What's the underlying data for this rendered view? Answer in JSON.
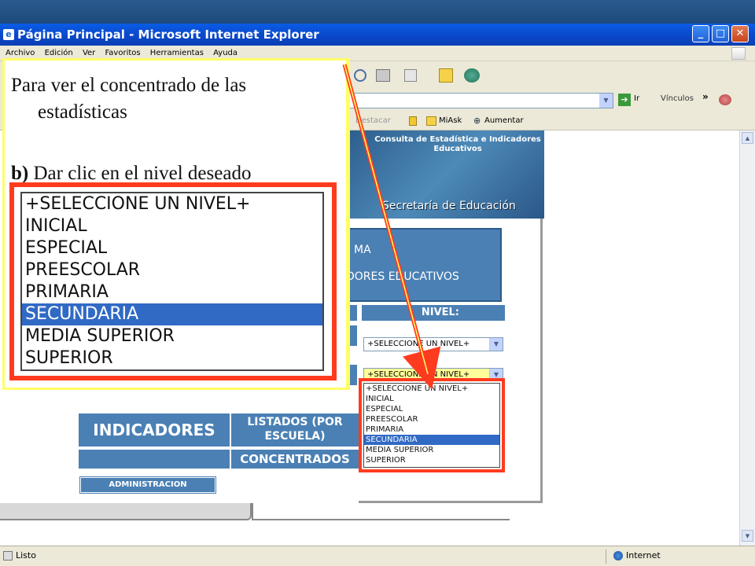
{
  "window": {
    "title": "Página Principal - Microsoft Internet Explorer",
    "controls": {
      "minimize": "_",
      "maximize": "□",
      "close": "✕"
    }
  },
  "menubar": {
    "items": [
      "Archivo",
      "Edición",
      "Ver",
      "Favoritos",
      "Herramientas",
      "Ayuda"
    ]
  },
  "addressbar": {
    "go_label": "Ir",
    "links_label": "Vínculos"
  },
  "linksbar": {
    "items": [
      "Destacar",
      "MiAsk",
      "Aumentar"
    ]
  },
  "callout": {
    "line1": "Para ver el concentrado de las",
    "line2": "estadísticas",
    "line3_bold": "b)",
    "line3_rest": " Dar clic en el nivel deseado"
  },
  "level_options": [
    "+SELECCIONE UN NIVEL+",
    "INICIAL",
    "ESPECIAL",
    "PREESCOLAR",
    "PRIMARIA",
    "SECUNDARIA",
    "MEDIA SUPERIOR",
    "SUPERIOR"
  ],
  "selected_option_index": 5,
  "banner": {
    "title": "Consulta de Estadística e Indicadores Educativos",
    "org": "Secretaría de Educación"
  },
  "panel": {
    "sistema_line1": "MA",
    "sistema_line2": "DORES EDUCATIVOS",
    "nivel_header": "NIVEL:",
    "select1_value": "+SELECCIONE UN NIVEL+",
    "select2_value": "+SELECCIONE UN NIVEL+"
  },
  "nav": {
    "indicadores": "INDICADORES",
    "listados": "LISTADOS (POR ESCUELA)",
    "concentrados": "CONCENTRADOS",
    "administracion": "ADMINISTRACION"
  },
  "statusbar": {
    "status": "Listo",
    "zone": "Internet"
  },
  "colors": {
    "highlight": "#316ac5",
    "callout_border": "#ff3b1f",
    "panel_blue": "#4a80b4"
  }
}
